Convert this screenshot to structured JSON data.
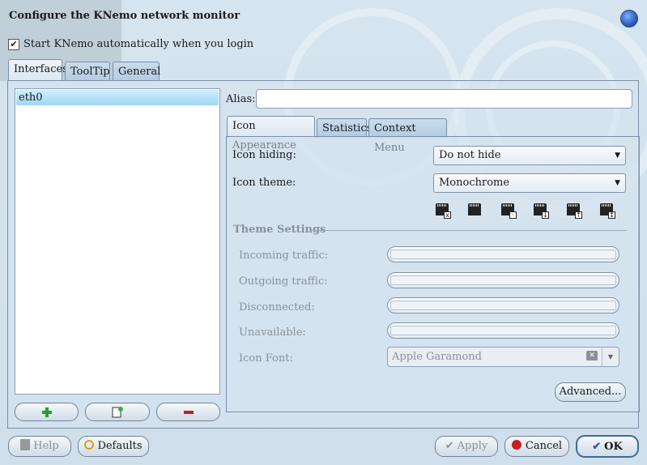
{
  "window": {
    "title": "Configure the KNemo network monitor"
  },
  "autostart": {
    "label": "Start KNemo automatically when you login",
    "checked": true,
    "checkmark": "✔"
  },
  "main_tabs": [
    {
      "label": "Interfaces",
      "active": true
    },
    {
      "label": "ToolTip",
      "active": false
    },
    {
      "label": "General",
      "active": false
    }
  ],
  "interfaces": {
    "items": [
      "eth0"
    ],
    "selected": "eth0"
  },
  "alias": {
    "label": "Alias:",
    "value": ""
  },
  "sub_tabs": [
    {
      "label": "Icon Appearance",
      "active": true
    },
    {
      "label": "Statistics",
      "active": false
    },
    {
      "label": "Context Menu",
      "active": false
    }
  ],
  "icon_hiding": {
    "label": "Icon hiding:",
    "value": "Do not hide"
  },
  "icon_theme": {
    "label": "Icon theme:",
    "value": "Monochrome"
  },
  "theme_icons": [
    "disconnected-icon",
    "idle-icon",
    "incoming-icon",
    "receive-icon",
    "transmit-icon",
    "both-icon"
  ],
  "theme_settings": {
    "heading": "Theme Settings",
    "incoming": "Incoming traffic:",
    "outgoing": "Outgoing traffic:",
    "disconnected": "Disconnected:",
    "unavailable": "Unavailable:",
    "icon_font_label": "Icon Font:",
    "icon_font_value": "Apple Garamond"
  },
  "advanced_button": "Advanced...",
  "bottom": {
    "help": "Help",
    "defaults": "Defaults",
    "apply": "Apply",
    "cancel": "Cancel",
    "ok": "OK"
  },
  "colors": {
    "accent": "#9fd6f7",
    "background": "#d6e4ef"
  }
}
